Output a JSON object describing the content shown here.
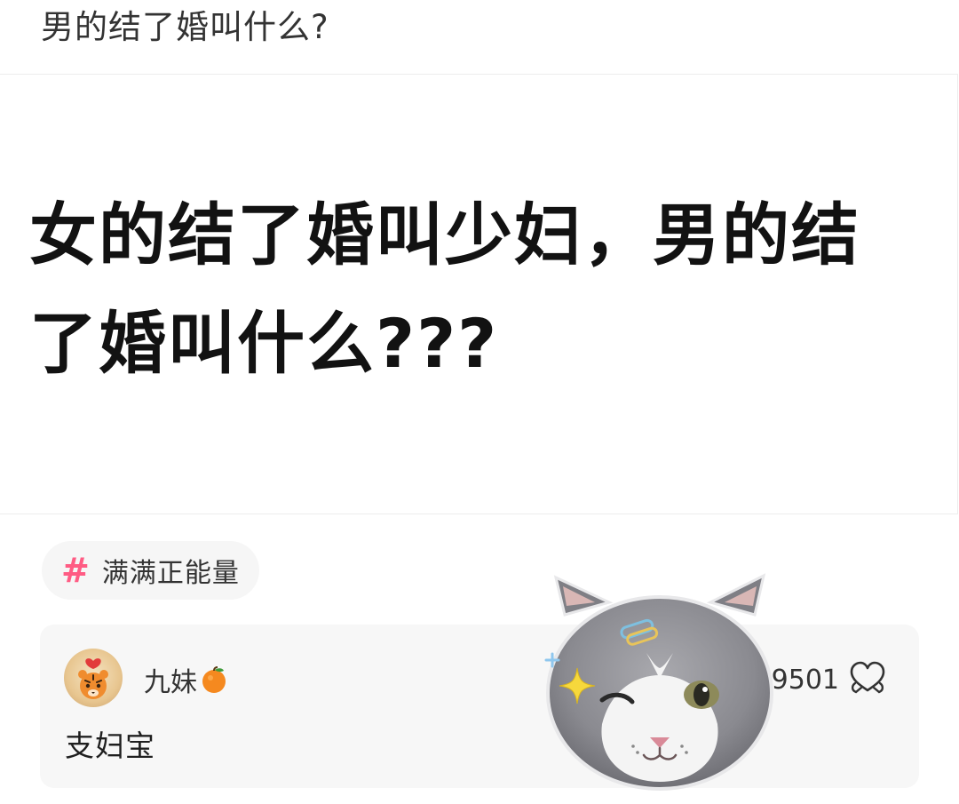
{
  "post": {
    "title": "男的结了婚叫什么?",
    "image_text_line1": "女的结了婚叫少妇，男的结",
    "image_text_line2": "了婚叫什么???"
  },
  "topic": {
    "hash_symbol": "#",
    "label": "满满正能量"
  },
  "comment": {
    "author": "九妹",
    "text": "支妇宝",
    "like_count": "9501"
  },
  "icons": {
    "topic": "hashtag-icon",
    "like": "heart-hands-icon",
    "author_badge": "orange-emoji-icon",
    "sticker": "winking-cat-sticker"
  },
  "colors": {
    "accent_pink": "#ff5c84",
    "text_primary": "#333333",
    "card_bg": "#f7f7f7"
  }
}
